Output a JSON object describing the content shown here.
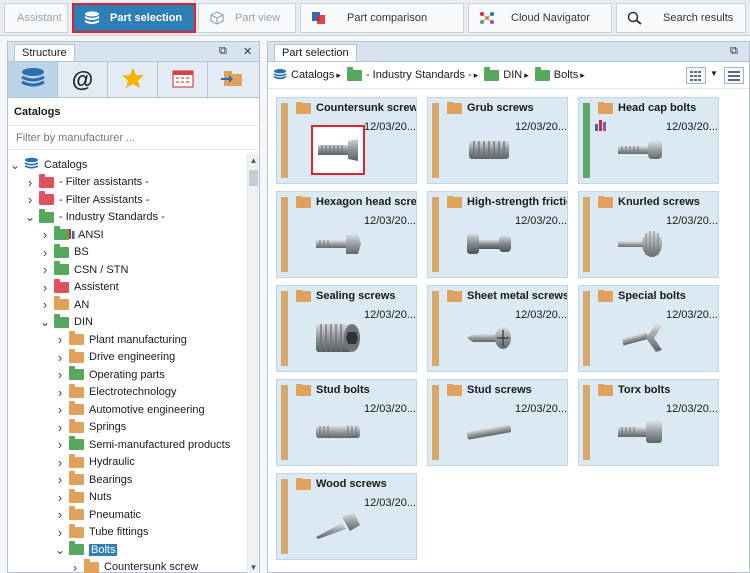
{
  "tabs": [
    {
      "label": "Assistant",
      "icon": "assistant",
      "state": "disabled"
    },
    {
      "label": "Part selection",
      "icon": "stack-icon",
      "state": "active"
    },
    {
      "label": "Part view",
      "icon": "cube-icon",
      "state": "disabled"
    },
    {
      "label": "Part comparison",
      "icon": "compare-icon",
      "state": "normal"
    },
    {
      "label": "Cloud Navigator",
      "icon": "cloud-navigator-icon",
      "state": "normal"
    },
    {
      "label": "Search results",
      "icon": "search-icon",
      "state": "normal"
    }
  ],
  "structure_panel": {
    "title": "Structure",
    "pin": "⧉",
    "close": "✕",
    "section_label": "Catalogs",
    "filter_placeholder": "Filter by manufacturer ..."
  },
  "tree": [
    {
      "label": "Catalogs",
      "level": 0,
      "arrow": "down",
      "icon": "catalogs"
    },
    {
      "label": "- Filter assistants -",
      "level": 1,
      "arrow": "right",
      "icon": "red"
    },
    {
      "label": "- Filter Assistants -",
      "level": 1,
      "arrow": "right",
      "icon": "red"
    },
    {
      "label": "- Industry Standards -",
      "level": 1,
      "arrow": "down",
      "icon": "green"
    },
    {
      "label": "ANSI",
      "level": 2,
      "arrow": "right",
      "icon": "green-chart"
    },
    {
      "label": "BS",
      "level": 2,
      "arrow": "right",
      "icon": "green"
    },
    {
      "label": "CSN / STN",
      "level": 2,
      "arrow": "right",
      "icon": "green"
    },
    {
      "label": "Assistent",
      "level": 2,
      "arrow": "right",
      "icon": "red"
    },
    {
      "label": "AN",
      "level": 2,
      "arrow": "right",
      "icon": "orange"
    },
    {
      "label": "DIN",
      "level": 2,
      "arrow": "down",
      "icon": "green"
    },
    {
      "label": "Plant manufacturing",
      "level": 3,
      "arrow": "right",
      "icon": "orange"
    },
    {
      "label": "Drive engineering",
      "level": 3,
      "arrow": "right",
      "icon": "orange"
    },
    {
      "label": "Operating parts",
      "level": 3,
      "arrow": "right",
      "icon": "green"
    },
    {
      "label": "Electrotechnology",
      "level": 3,
      "arrow": "right",
      "icon": "orange"
    },
    {
      "label": "Automotive engineering",
      "level": 3,
      "arrow": "right",
      "icon": "orange"
    },
    {
      "label": "Springs",
      "level": 3,
      "arrow": "right",
      "icon": "orange"
    },
    {
      "label": "Semi-manufactured products",
      "level": 3,
      "arrow": "right",
      "icon": "green"
    },
    {
      "label": "Hydraulic",
      "level": 3,
      "arrow": "right",
      "icon": "orange"
    },
    {
      "label": "Bearings",
      "level": 3,
      "arrow": "right",
      "icon": "orange"
    },
    {
      "label": "Nuts",
      "level": 3,
      "arrow": "right",
      "icon": "orange"
    },
    {
      "label": "Pneumatic",
      "level": 3,
      "arrow": "right",
      "icon": "orange"
    },
    {
      "label": "Tube fittings",
      "level": 3,
      "arrow": "right",
      "icon": "orange"
    },
    {
      "label": "Bolts",
      "level": 3,
      "arrow": "down",
      "icon": "green",
      "selected": true
    },
    {
      "label": "Countersunk screw",
      "level": 4,
      "arrow": "right",
      "icon": "orange"
    }
  ],
  "part_panel": {
    "title": "Part selection",
    "pin": "⧉",
    "breadcrumb": [
      {
        "label": "Catalogs",
        "icon": "catalogs"
      },
      {
        "label": "- Industry Standards -",
        "icon": "green"
      },
      {
        "label": "DIN",
        "icon": "green"
      },
      {
        "label": "Bolts",
        "icon": "green"
      }
    ]
  },
  "cards": [
    {
      "name": "Countersunk screw",
      "date": "12/03/20...",
      "thumb": "countersunk",
      "highlight": true,
      "stripe": "orange"
    },
    {
      "name": "Grub screws",
      "date": "12/03/20...",
      "thumb": "grub",
      "stripe": "orange"
    },
    {
      "name": "Head cap bolts",
      "date": "12/03/20...",
      "thumb": "headcap",
      "stripe": "green",
      "badge": true
    },
    {
      "name": "Hexagon head screw",
      "date": "12/03/20...",
      "thumb": "hexagon",
      "stripe": "orange"
    },
    {
      "name": "High-strength frictio",
      "date": "12/03/20...",
      "thumb": "friction",
      "stripe": "orange"
    },
    {
      "name": "Knurled screws",
      "date": "12/03/20...",
      "thumb": "knurled",
      "stripe": "orange"
    },
    {
      "name": "Sealing screws",
      "date": "12/03/20...",
      "thumb": "sealing",
      "stripe": "orange"
    },
    {
      "name": "Sheet metal screws",
      "date": "12/03/20...",
      "thumb": "sheetmetal",
      "stripe": "orange"
    },
    {
      "name": "Special bolts",
      "date": "12/03/20...",
      "thumb": "wingbolt",
      "stripe": "orange"
    },
    {
      "name": "Stud bolts",
      "date": "12/03/20...",
      "thumb": "stud",
      "stripe": "orange"
    },
    {
      "name": "Stud screws",
      "date": "12/03/20...",
      "thumb": "studscrew",
      "stripe": "orange"
    },
    {
      "name": "Torx bolts",
      "date": "12/03/20...",
      "thumb": "torx",
      "stripe": "orange"
    },
    {
      "name": "Wood screws",
      "date": "12/03/20...",
      "thumb": "wood",
      "stripe": "orange"
    }
  ]
}
